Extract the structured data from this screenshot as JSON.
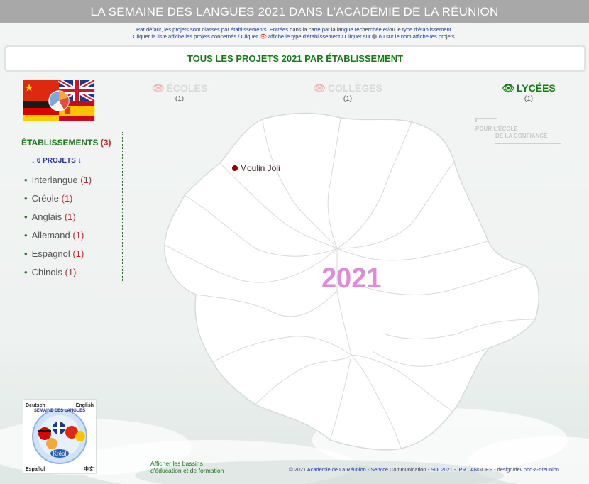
{
  "header": {
    "title": "LA SEMAINE DES LANGUES 2021 DANS L'ACADÉMIE DE LA RÉUNION"
  },
  "intro": {
    "line1": "Par défaut, les projets sont classés par établissements. Entrées dans la carte par la langue recherchée et/ou le type d'établissement.",
    "line2a": "Cliquer la liste affiche les projets concernés / Cliquer",
    "line2b": "affiche le type d'établissement / Cliquer sur",
    "line2c": "ou sur le nom affiche les projets."
  },
  "section_title": "TOUS LES PROJETS 2021 PAR ÉTABLISSEMENT",
  "levels": [
    {
      "label": "ÉCOLES",
      "count": "(1)",
      "active": false
    },
    {
      "label": "COLLÈGES",
      "count": "(1)",
      "active": false
    },
    {
      "label": "LYCÉES",
      "count": "(1)",
      "active": true
    }
  ],
  "confiance": {
    "line1": "POUR L'ÉCOLE",
    "line2": "DE LA CONFIANCE"
  },
  "sidebar": {
    "etablissements_label": "ÉTABLISSEMENTS",
    "etablissements_count": "(3)",
    "projets": "↓ 6 PROJETS ↓",
    "languages": [
      {
        "name": "Interlangue",
        "count": "(1)"
      },
      {
        "name": "Créole",
        "count": "(1)"
      },
      {
        "name": "Anglais",
        "count": "(1)"
      },
      {
        "name": "Allemand",
        "count": "(1)"
      },
      {
        "name": "Espagnol",
        "count": "(1)"
      },
      {
        "name": "Chinois",
        "count": "(1)"
      }
    ]
  },
  "map": {
    "year": "2021",
    "year_color": "#e08ad8",
    "marker": {
      "label": "Moulin Joli"
    }
  },
  "logo": {
    "corner_tl": "Deutsch",
    "corner_tr": "English",
    "corner_bl": "Español",
    "corner_br": "中文",
    "arc": "SEMAINE DES LANGUES",
    "center": "Kréol"
  },
  "footer": {
    "bassins_line1": "Afficher les bassins",
    "bassins_line2": "d'éducation et de formation",
    "copyright": "© 2021 Académie de La Réunion - Service Communication - SDL2021 - IPR LANGUES - design/dev.phd-a-oreunion"
  },
  "colors": {
    "accent_green": "#1a7a1a",
    "count_red": "#c8242a",
    "header_grey": "#a8a8a8"
  }
}
